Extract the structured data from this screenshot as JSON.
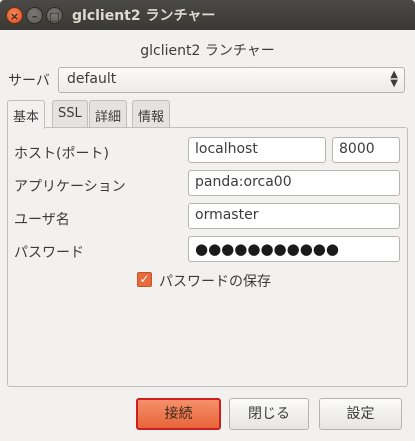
{
  "window": {
    "title": "glclient2 ランチャー",
    "controls": {
      "close": "×",
      "minimize": "–",
      "maximize": "□"
    }
  },
  "heading": "glclient2 ランチャー",
  "server": {
    "label": "サーバ",
    "value": "default"
  },
  "tabs": [
    {
      "label": "基本",
      "active": true
    },
    {
      "label": "SSL",
      "active": false
    },
    {
      "label": "詳細",
      "active": false
    },
    {
      "label": "情報",
      "active": false
    }
  ],
  "fields": {
    "host_label": "ホスト(ポート)",
    "host_value": "localhost",
    "port_value": "8000",
    "app_label": "アプリケーション",
    "app_value": "panda:orca00",
    "user_label": "ユーザ名",
    "user_value": "ormaster",
    "password_label": "パスワード",
    "password_value": "●●●●●●●●●●●"
  },
  "save_password": {
    "label": "パスワードの保存",
    "checked": true,
    "mark": "✓"
  },
  "buttons": {
    "connect": "接続",
    "close": "閉じる",
    "settings": "設定"
  },
  "colors": {
    "accent": "#e8653a",
    "focus_border": "#cc1f1f",
    "titlebar": "#3c3b37"
  }
}
